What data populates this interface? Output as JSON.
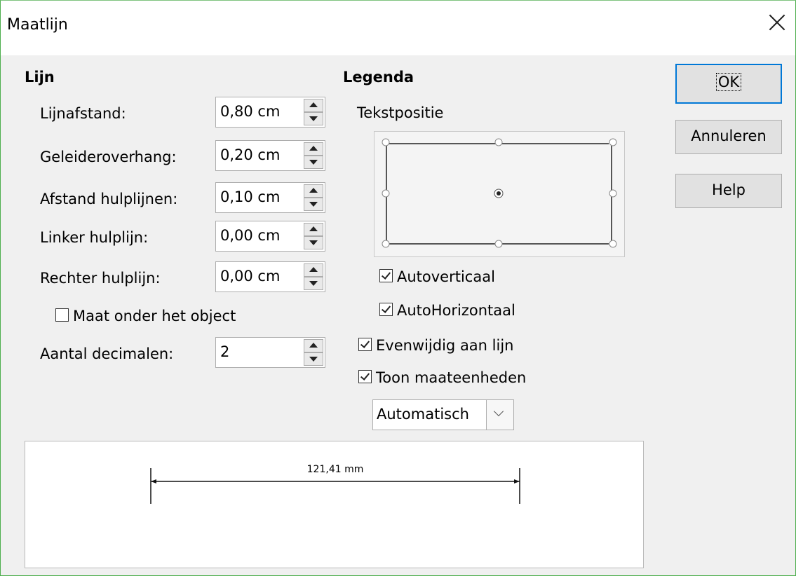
{
  "window": {
    "title": "Maatlijn"
  },
  "line_section": {
    "heading": "Lijn",
    "fields": [
      {
        "label": "Lijnafstand:",
        "value": "0,80 cm"
      },
      {
        "label": "Geleideroverhang:",
        "value": "0,20 cm"
      },
      {
        "label": "Afstand hulplijnen:",
        "value": "0,10 cm"
      },
      {
        "label": "Linker hulplijn:",
        "value": "0,00 cm"
      },
      {
        "label": "Rechter hulplijn:",
        "value": "0,00 cm"
      }
    ],
    "below_object": {
      "label": "Maat onder het object",
      "checked": false
    },
    "decimals": {
      "label": "Aantal decimalen:",
      "value": "2"
    }
  },
  "legend_section": {
    "heading": "Legenda",
    "text_position_label": "Tekstpositie",
    "selected_position": "center",
    "auto_vertical": {
      "label": "Autoverticaal",
      "checked": true
    },
    "auto_horizontal": {
      "label": "AutoHorizontaal",
      "checked": true
    },
    "parallel": {
      "label": "Evenwijdig aan lijn",
      "checked": true
    },
    "show_units": {
      "label": "Toon maateenheden",
      "checked": true
    },
    "unit_select": {
      "value": "Automatisch"
    }
  },
  "buttons": {
    "ok": "OK",
    "cancel": "Annuleren",
    "help": "Help"
  },
  "preview": {
    "measure_text": "121,41 mm"
  }
}
